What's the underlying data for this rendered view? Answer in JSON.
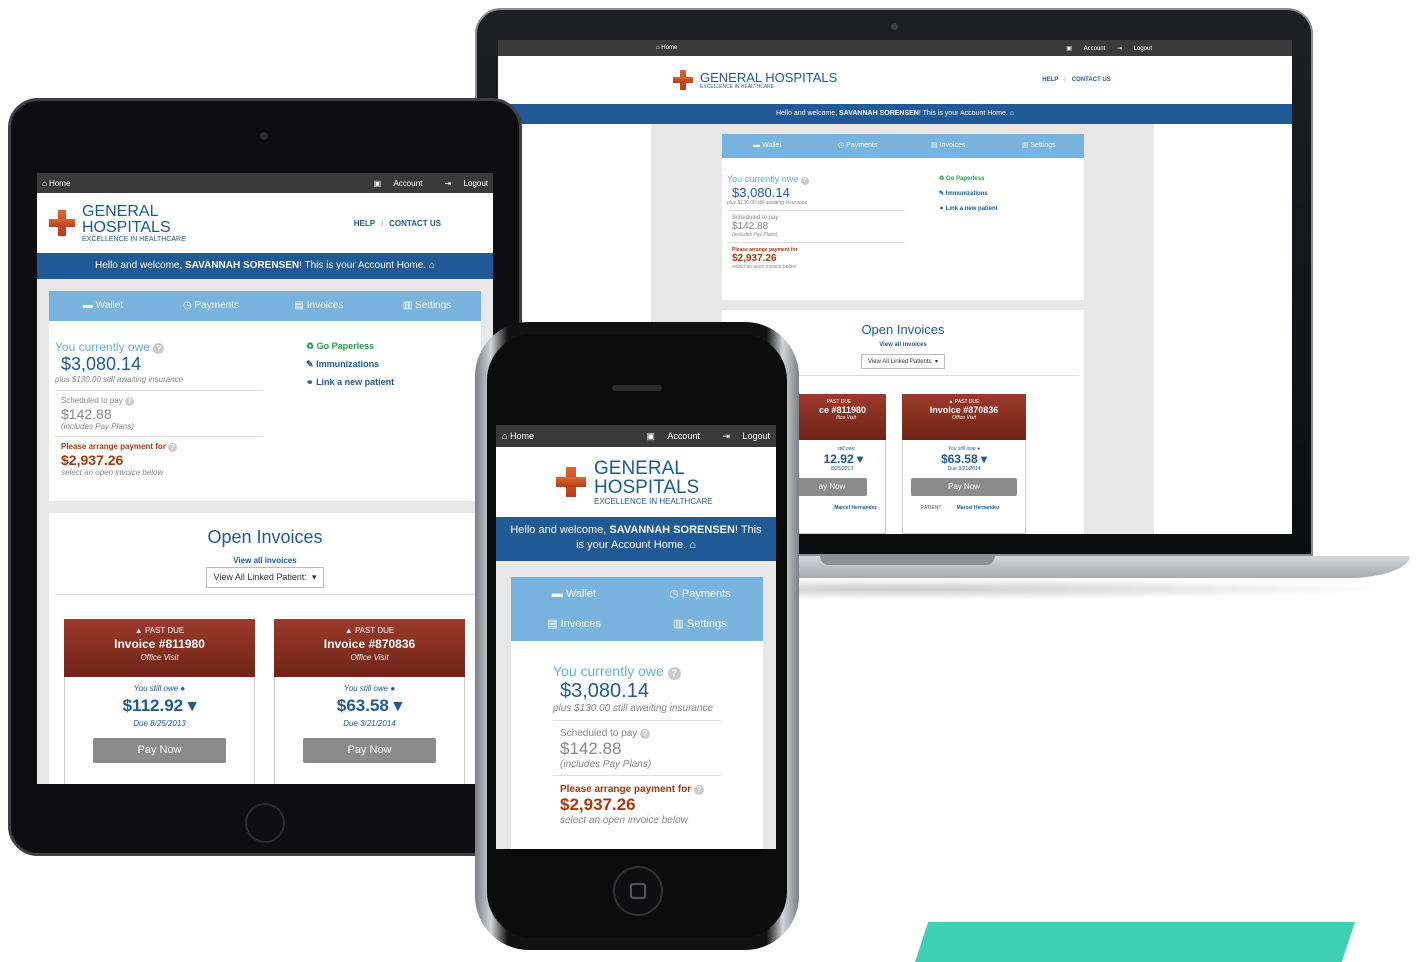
{
  "topbar": {
    "home": "Home",
    "account": "Account",
    "logout": "Logout"
  },
  "brand": {
    "line1": "GENERAL",
    "line2": "HOSPITALS",
    "full": "GENERAL HOSPITALS",
    "tagline": "EXCELLENCE IN HEALTHCARE"
  },
  "links": {
    "help": "HELP",
    "contact": "CONTACT US"
  },
  "welcome": {
    "pre": "Hello and welcome,",
    "name": "SAVANNAH SORENSEN",
    "post": "! This is your Account Home.",
    "post_a": "! This",
    "post_b": "is your Account Home."
  },
  "nav": {
    "wallet": "Wallet",
    "payments": "Payments",
    "invoices": "Invoices",
    "settings": "Settings"
  },
  "balance": {
    "owe_label": "You currently owe",
    "owe_value": "$3,080.14",
    "insurance_note": "plus $130.00 still awaiting insurance",
    "scheduled_label": "Scheduled to pay",
    "scheduled_value": "$142.88",
    "scheduled_note": "(includes Pay Plans)",
    "arrange_label": "Please arrange payment for",
    "arrange_value": "$2,937.26",
    "arrange_note": "select an open invoice below"
  },
  "quick_links": {
    "paperless": "Go Paperless",
    "immunizations": "Immunizations",
    "link_patient": "Link a new patient"
  },
  "open_invoices": {
    "title": "Open Invoices",
    "view_all": "View all invoices",
    "filter_value": "View All Linked Patients",
    "filter_value_short": "View All Linked Patient:",
    "invoices": [
      {
        "status": "PAST DUE",
        "number": "Invoice #811980",
        "number_partial": "ce #811980",
        "type": "Office Visit",
        "type_partial": "ffice Visit",
        "still_owe": "You still owe",
        "still_owe_partial": "still owe",
        "amount": "$112.92",
        "amount_partial": "12.92",
        "due": "Due 8/25/2013",
        "due_partial": "8/25/2013",
        "pay": "Pay Now",
        "pay_partial": "ay Now",
        "patient_name": "Marcel Hernandez"
      },
      {
        "status": "PAST DUE",
        "number": "Invoice #870836",
        "type": "Office Visit",
        "still_owe": "You still owe",
        "amount": "$63.58",
        "due": "Due 3/21/2014",
        "pay": "Pay Now",
        "patient_label": "PATIENT",
        "patient_name": "Marcel Hernandez"
      }
    ]
  },
  "icons": {
    "home": "home-icon",
    "account": "account-icon",
    "logout": "logout-icon",
    "wallet": "wallet-icon",
    "payments": "payments-icon",
    "invoices": "invoices-icon",
    "settings": "settings-icon",
    "help": "question-icon",
    "recycle": "recycle-icon",
    "syringe": "syringe-icon",
    "link": "link-icon",
    "warning": "warning-icon",
    "info": "info-icon",
    "caret": "caret-down-icon"
  },
  "colors": {
    "brand_blue": "#1f5a96",
    "nav_blue": "#79b3e0",
    "past_due": "#8a2f21",
    "alert_orange": "#a33a10",
    "accent_teal": "#3fd0b4"
  }
}
